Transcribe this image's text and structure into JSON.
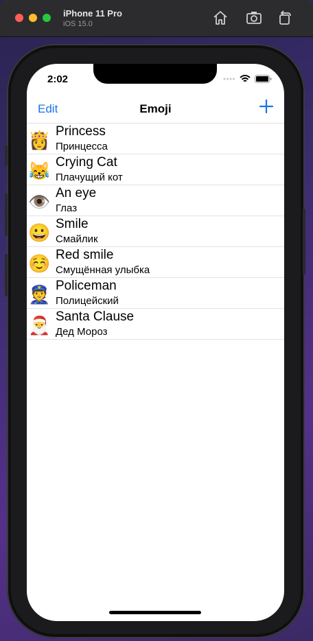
{
  "window": {
    "device_name": "iPhone 11 Pro",
    "os_version": "iOS 15.0",
    "icons": [
      "home-icon",
      "screenshot-icon",
      "rotate-icon"
    ]
  },
  "status_bar": {
    "time": "2:02",
    "icons": [
      "signal-icon",
      "wifi-icon",
      "battery-icon"
    ]
  },
  "navbar": {
    "edit_label": "Edit",
    "title": "Emoji",
    "add_icon": "plus-icon",
    "accent": "#1a73e8"
  },
  "items": [
    {
      "emoji": "👸",
      "title": "Princess",
      "subtitle": "Принцесса"
    },
    {
      "emoji": "😹",
      "title": "Crying Cat",
      "subtitle": "Плачущий кот"
    },
    {
      "emoji": "👁️",
      "title": "An eye",
      "subtitle": "Глаз"
    },
    {
      "emoji": "😀",
      "title": "Smile",
      "subtitle": "Смайлик"
    },
    {
      "emoji": "☺️",
      "title": "Red smile",
      "subtitle": "Смущённая улыбка"
    },
    {
      "emoji": "👮",
      "title": "Policeman",
      "subtitle": "Полицейский"
    },
    {
      "emoji": "🎅",
      "title": "Santa Clause",
      "subtitle": "Дед Мороз"
    }
  ]
}
